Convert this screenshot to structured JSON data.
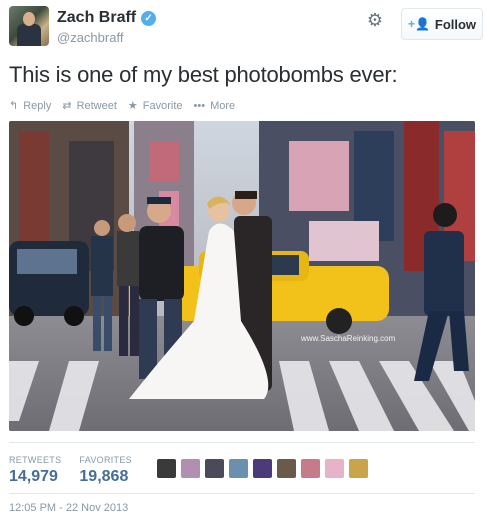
{
  "user": {
    "name": "Zach Braff",
    "handle": "@zachbraff",
    "verified_glyph": "✓"
  },
  "follow": {
    "icon": "+👤",
    "label": "Follow"
  },
  "tweet": {
    "text": "This is one of my best photobombs ever:"
  },
  "actions": [
    {
      "icon": "reply-icon",
      "glyph": "↰",
      "label": "Reply"
    },
    {
      "icon": "retweet-icon",
      "glyph": "⇄",
      "label": "Retweet"
    },
    {
      "icon": "star-icon",
      "glyph": "★",
      "label": "Favorite"
    },
    {
      "icon": "more-icon",
      "glyph": "•••",
      "label": "More"
    }
  ],
  "photo": {
    "watermark": "www.SaschaReinking.com"
  },
  "stats": {
    "retweets_label": "RETWEETS",
    "retweets_value": "14,979",
    "favorites_label": "FAVORITES",
    "favorites_value": "19,868"
  },
  "favoriters_colors": [
    "#3a3a3a",
    "#b08fb0",
    "#4a4a5a",
    "#6b8fae",
    "#4b3b7a",
    "#6a5a4a",
    "#c77a8a",
    "#e6b3c8",
    "#c9a44a"
  ],
  "timestamp": "12:05 PM - 22 Nov 2013",
  "colors": {
    "accent": "#55acee",
    "link": "#476d96",
    "muted": "#8899a6"
  }
}
